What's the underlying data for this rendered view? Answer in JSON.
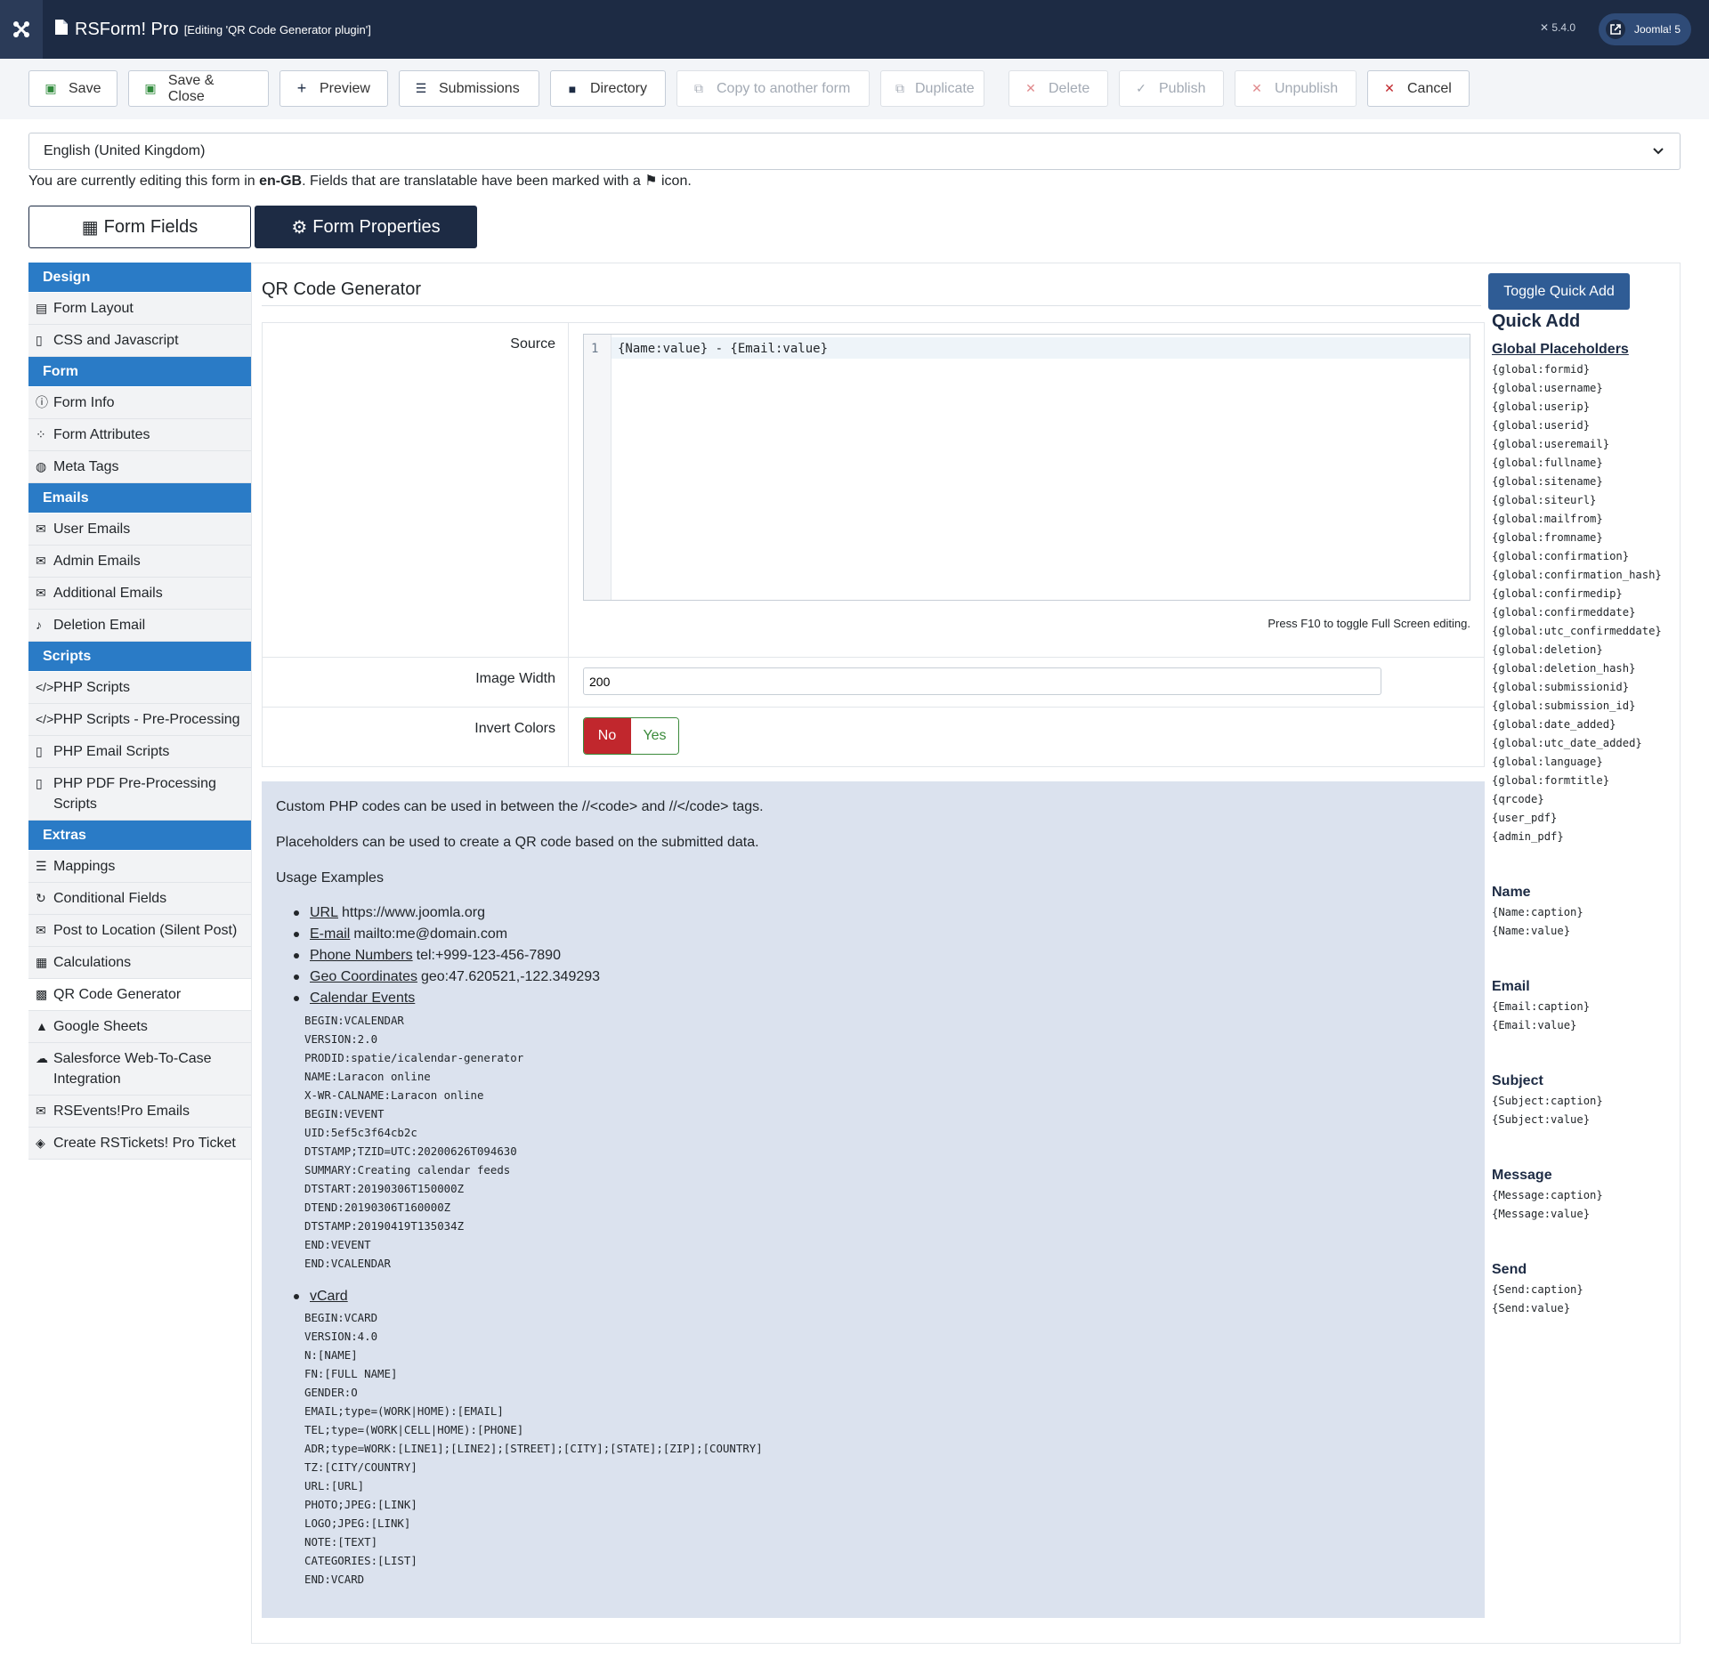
{
  "header": {
    "app_title": "RSForm! Pro",
    "subtitle": "[Editing 'QR Code Generator plugin']",
    "version": "5.4.0",
    "site_button": "Joomla! 5"
  },
  "toolbar": {
    "buttons": [
      {
        "label": "Save",
        "icon": "floppy-disk-icon"
      },
      {
        "label": "Save & Close",
        "icon": "floppy-disk-icon"
      },
      {
        "label": "Preview",
        "icon": "plus-icon"
      },
      {
        "label": "Submissions",
        "icon": "database-icon"
      },
      {
        "label": "Directory",
        "icon": "folder-icon"
      },
      {
        "label": "Copy to another form",
        "icon": "copy-icon"
      },
      {
        "label": "Duplicate",
        "icon": "copy-icon"
      },
      {
        "label": "Delete",
        "icon": "x-icon"
      },
      {
        "label": "Publish",
        "icon": "check-icon"
      },
      {
        "label": "Unpublish",
        "icon": "x-icon"
      },
      {
        "label": "Cancel",
        "icon": "x-icon"
      }
    ]
  },
  "language": {
    "selected": "English (United Kingdom)",
    "note_pre": "You are currently editing this form in ",
    "note_code": "en-GB",
    "note_post": ". Fields that are translatable have been marked with a ",
    "note_end": " icon."
  },
  "tabs": {
    "fields": "Form Fields",
    "properties": "Form Properties"
  },
  "sidebar": {
    "design": "Design",
    "design_items": [
      "Form Layout",
      "CSS and Javascript"
    ],
    "form": "Form",
    "form_items": [
      "Form Info",
      "Form Attributes",
      "Meta Tags"
    ],
    "emails": "Emails",
    "emails_items": [
      "User Emails",
      "Admin Emails",
      "Additional Emails",
      "Deletion Email"
    ],
    "scripts": "Scripts",
    "scripts_items": [
      "PHP Scripts",
      "PHP Scripts - Pre-Processing",
      "PHP Email Scripts",
      "PHP PDF Pre-Processing Scripts"
    ],
    "extras": "Extras",
    "extras_items": [
      "Mappings",
      "Conditional Fields",
      "Post to Location (Silent Post)",
      "Calculations",
      "QR Code Generator",
      "Google Sheets",
      "Salesforce Web-To-Case Integration",
      "RSEvents!Pro Emails",
      "Create RSTickets! Pro Ticket"
    ]
  },
  "main": {
    "title": "QR Code Generator",
    "source_label": "Source",
    "source_line": "1",
    "source_code": "{Name:value} - {Email:value}",
    "fullscreen_hint": "Press F10 to toggle Full Screen editing.",
    "width_label": "Image Width",
    "width_value": "200",
    "invert_label": "Invert Colors",
    "invert_no": "No",
    "invert_yes": "Yes"
  },
  "info": {
    "p1": "Custom PHP codes can be used in between the //<code> and //</code> tags.",
    "p2": "Placeholders can be used to create a QR code based on the submitted data.",
    "p3": "Usage Examples",
    "url_label": "URL",
    "url_value": "https://www.joomla.org",
    "email_label": "E-mail",
    "email_value": "mailto:me@domain.com",
    "phone_label": "Phone Numbers",
    "phone_value": "tel:+999-123-456-7890",
    "geo_label": "Geo Coordinates",
    "geo_value": "geo:47.620521,-122.349293",
    "cal_label": "Calendar Events",
    "cal_code": "BEGIN:VCALENDAR\nVERSION:2.0\nPRODID:spatie/icalendar-generator\nNAME:Laracon online\nX-WR-CALNAME:Laracon online\nBEGIN:VEVENT\nUID:5ef5c3f64cb2c\nDTSTAMP;TZID=UTC:20200626T094630\nSUMMARY:Creating calendar feeds\nDTSTART:20190306T150000Z\nDTEND:20190306T160000Z\nDTSTAMP:20190419T135034Z\nEND:VEVENT\nEND:VCALENDAR",
    "vcard_label": "vCard",
    "vcard_code": "BEGIN:VCARD\nVERSION:4.0\nN:[NAME]\nFN:[FULL NAME]\nGENDER:O\nEMAIL;type=(WORK|HOME):[EMAIL]\nTEL;type=(WORK|CELL|HOME):[PHONE]\nADR;type=WORK:[LINE1];[LINE2];[STREET];[CITY];[STATE];[ZIP];[COUNTRY]\nTZ:[CITY/COUNTRY]\nURL:[URL]\nPHOTO;JPEG:[LINK]\nLOGO;JPEG:[LINK]\nNOTE:[TEXT]\nCATEGORIES:[LIST]\nEND:VCARD"
  },
  "quick_add": {
    "button": "Toggle Quick Add",
    "title": "Quick Add",
    "global_title": "Global Placeholders",
    "global_list": "{global:formid}\n{global:username}\n{global:userip}\n{global:userid}\n{global:useremail}\n{global:fullname}\n{global:sitename}\n{global:siteurl}\n{global:mailfrom}\n{global:fromname}\n{global:confirmation}\n{global:confirmation_hash}\n{global:confirmedip}\n{global:confirmeddate}\n{global:utc_confirmeddate}\n{global:deletion}\n{global:deletion_hash}\n{global:submissionid}\n{global:submission_id}\n{global:date_added}\n{global:utc_date_added}\n{global:language}\n{global:formtitle}\n{qrcode}\n{user_pdf}\n{admin_pdf}",
    "name_title": "Name",
    "name_list": "{Name:caption}\n{Name:value}",
    "email_title": "Email",
    "email_list": "{Email:caption}\n{Email:value}",
    "subject_title": "Subject",
    "subject_list": "{Subject:caption}\n{Subject:value}",
    "message_title": "Message",
    "message_list": "{Message:caption}\n{Message:value}",
    "send_title": "Send",
    "send_list": "{Send:caption}\n{Send:value}"
  }
}
